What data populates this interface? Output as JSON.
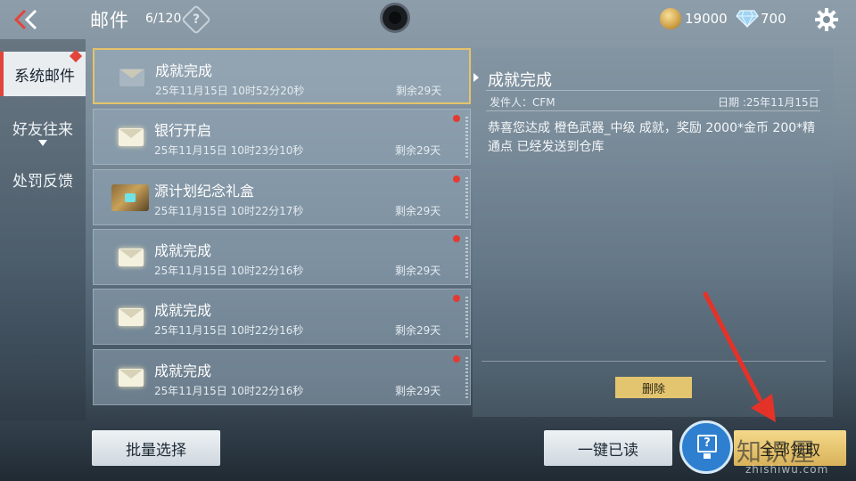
{
  "header": {
    "title": "邮件",
    "count": "6/120",
    "help": "?"
  },
  "currency": {
    "gold": "19000",
    "diamond": "700"
  },
  "tabs": [
    {
      "label": "系统邮件"
    },
    {
      "label": "好友往来"
    },
    {
      "label": "处罚反馈"
    }
  ],
  "mails": [
    {
      "title": "成就完成",
      "date": "25年11月15日 10时52分20秒",
      "remain": "剩余29天"
    },
    {
      "title": "银行开启",
      "date": "25年11月15日 10时23分10秒",
      "remain": "剩余29天"
    },
    {
      "title": "源计划纪念礼盒",
      "date": "25年11月15日 10时22分17秒",
      "remain": "剩余29天"
    },
    {
      "title": "成就完成",
      "date": "25年11月15日 10时22分16秒",
      "remain": "剩余29天"
    },
    {
      "title": "成就完成",
      "date": "25年11月15日 10时22分16秒",
      "remain": "剩余29天"
    },
    {
      "title": "成就完成",
      "date": "25年11月15日 10时22分16秒",
      "remain": "剩余29天"
    }
  ],
  "detail": {
    "title": "成就完成",
    "sender": "发件人：CFM",
    "date": "日期 :25年11月15日",
    "body": "恭喜您达成 橙色武器_中级 成就，奖励 2000*金币 200*精通点 已经发送到仓库",
    "delete_label": "删除"
  },
  "bottom": {
    "batch_label": "批量选择",
    "read_all_label": "一键已读",
    "claim_all_label": "全部领取"
  },
  "watermark": {
    "text": "知识屋",
    "url": "zhishiwu.com"
  },
  "colors": {
    "accent": "#e4c36a",
    "unread_dot": "#e33b32",
    "annotation_arrow": "#e53228"
  }
}
